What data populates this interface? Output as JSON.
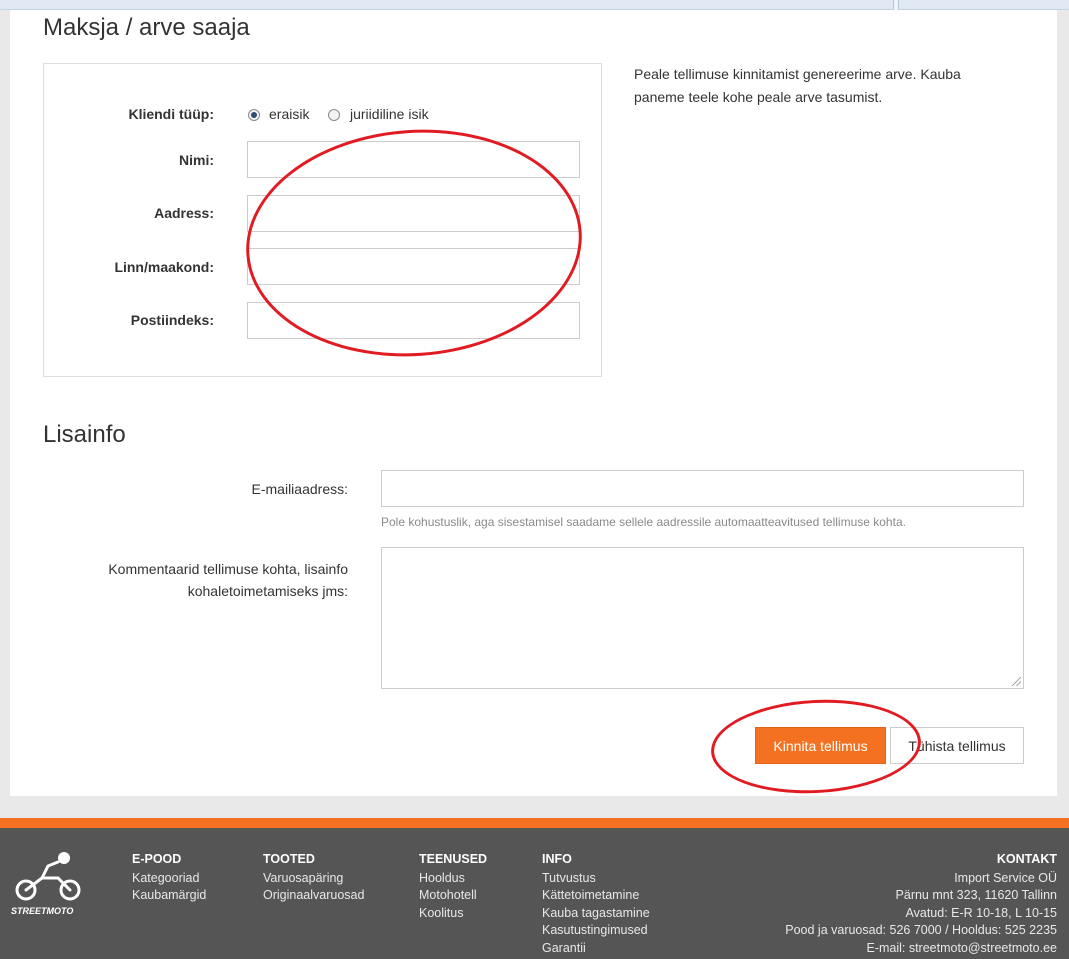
{
  "billing": {
    "title": "Maksja / arve saaja",
    "client_type_label": "Kliendi tüüp:",
    "client_type_options": [
      "eraisik",
      "juriidiline isik"
    ],
    "client_type_selected": "eraisik",
    "name_label": "Nimi:",
    "address_label": "Aadress:",
    "city_label": "Linn/maakond:",
    "postal_label": "Postiindeks:",
    "name_value": "",
    "address_value": "",
    "city_value": "",
    "postal_value": "",
    "info_text": "Peale tellimuse kinnitamist genereerime arve. Kauba paneme teele kohe peale arve tasumist."
  },
  "extra": {
    "title": "Lisainfo",
    "email_label": "E-mailiaadress:",
    "email_value": "",
    "email_help": "Pole kohustuslik, aga sisestamisel saadame sellele aadressile automaatteavitused tellimuse kohta.",
    "comments_label_line1": "Kommentaarid tellimuse kohta, lisainfo",
    "comments_label_line2": "kohaletoimetamiseks jms:",
    "comments_value": ""
  },
  "actions": {
    "confirm_label": "Kinnita tellimus",
    "cancel_label": "Tühista tellimus"
  },
  "footer": {
    "logo_text": "STREETMOTO",
    "columns": [
      {
        "title": "E-POOD",
        "links": [
          "Kategooriad",
          "Kaubamärgid"
        ]
      },
      {
        "title": "TOOTED",
        "links": [
          "Varuosapäring",
          "Originaalvaruosad"
        ]
      },
      {
        "title": "TEENUSED",
        "links": [
          "Hooldus",
          "Motohotell",
          "Koolitus"
        ]
      },
      {
        "title": "INFO",
        "links": [
          "Tutvustus",
          "Kättetoimetamine",
          "Kauba tagastamine",
          "Kasutustingimused",
          "Garantii"
        ]
      }
    ],
    "contact": {
      "title": "KONTAKT",
      "lines": [
        "Import Service OÜ",
        "Pärnu mnt 323, 11620 Tallinn",
        "Avatud: E-R 10-18, L 10-15",
        "Pood ja varuosad: 526 7000 / Hooldus: 525 2235",
        "E-mail: streetmoto@streetmoto.ee"
      ]
    }
  },
  "colors": {
    "accent": "#f57122",
    "annotation": "#e11b22",
    "footer_bg": "#555555"
  }
}
